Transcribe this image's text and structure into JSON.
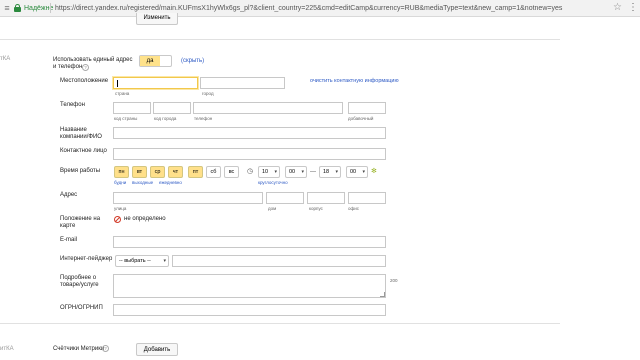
{
  "browser": {
    "secure_label": "Надёжне",
    "url": "https://direct.yandex.ru/registered/main.KUFmsX1hyWlx6gs_pl?&client_country=225&cmd=editCamp&currency=RUB&mediaType=text&new_camp=1&notnew=yes",
    "nav_icon": "≡",
    "star_icon": "☆",
    "menu_icon": "⋮"
  },
  "top_button": "Изменить",
  "side_letters": {
    "top": "тКА",
    "bottom": "итКА"
  },
  "unified_address": {
    "label_line1": "Использовать единый адрес",
    "label_line2": "и телефон",
    "help_icon": "?",
    "toggle_on": "да",
    "hide_link": "(скрыть)"
  },
  "location": {
    "label": "Местоположение",
    "country_hint": "страна",
    "city_hint": "город",
    "clear_link": "очистить контактную информацию"
  },
  "phone": {
    "label": "Телефон",
    "country_code_hint": "код страны",
    "city_code_hint": "код города",
    "phone_hint": "телефон",
    "ext_hint": "добавочный"
  },
  "company": {
    "label_line1": "Название",
    "label_line2": "компании/ФИО"
  },
  "contact_person": {
    "label": "Контактное лицо"
  },
  "work_time": {
    "label": "Время работы",
    "days": [
      "пн",
      "вт",
      "ср",
      "чт",
      "пт",
      "сб",
      "вс"
    ],
    "weekdays_hint": "будни",
    "days_off_hint": "выходные",
    "daily_hint": "ежедневно",
    "from_hour": "10",
    "from_min": "00",
    "dash": "—",
    "to_hour": "18",
    "to_min": "00",
    "round_clock_hint": "круглосуточно",
    "clock_icon": "◷",
    "add_icon": "✻"
  },
  "address": {
    "label": "Адрес",
    "street_hint": "улица",
    "house_hint": "дом",
    "building_hint": "корпус",
    "office_hint": "офис"
  },
  "map_position": {
    "label_line1": "Положение на",
    "label_line2": "карте",
    "value": "не определено"
  },
  "email": {
    "label": "E-mail"
  },
  "messenger": {
    "label": "Интернет-пейджер",
    "select_value": "-- выбрать --"
  },
  "details": {
    "label_line1": "Подробнее о",
    "label_line2": "товаре/услуге",
    "counter": "200"
  },
  "ogrn": {
    "label": "ОГРН/ОГРНИП"
  },
  "metrika": {
    "label": "Счётчики Метрики",
    "help_icon": "?",
    "add_button": "Добавить"
  },
  "colors": {
    "accent": "#ffe08a",
    "focus_border": "#f2c84b",
    "link": "#2b58c4",
    "secure": "#2b8a3e"
  }
}
